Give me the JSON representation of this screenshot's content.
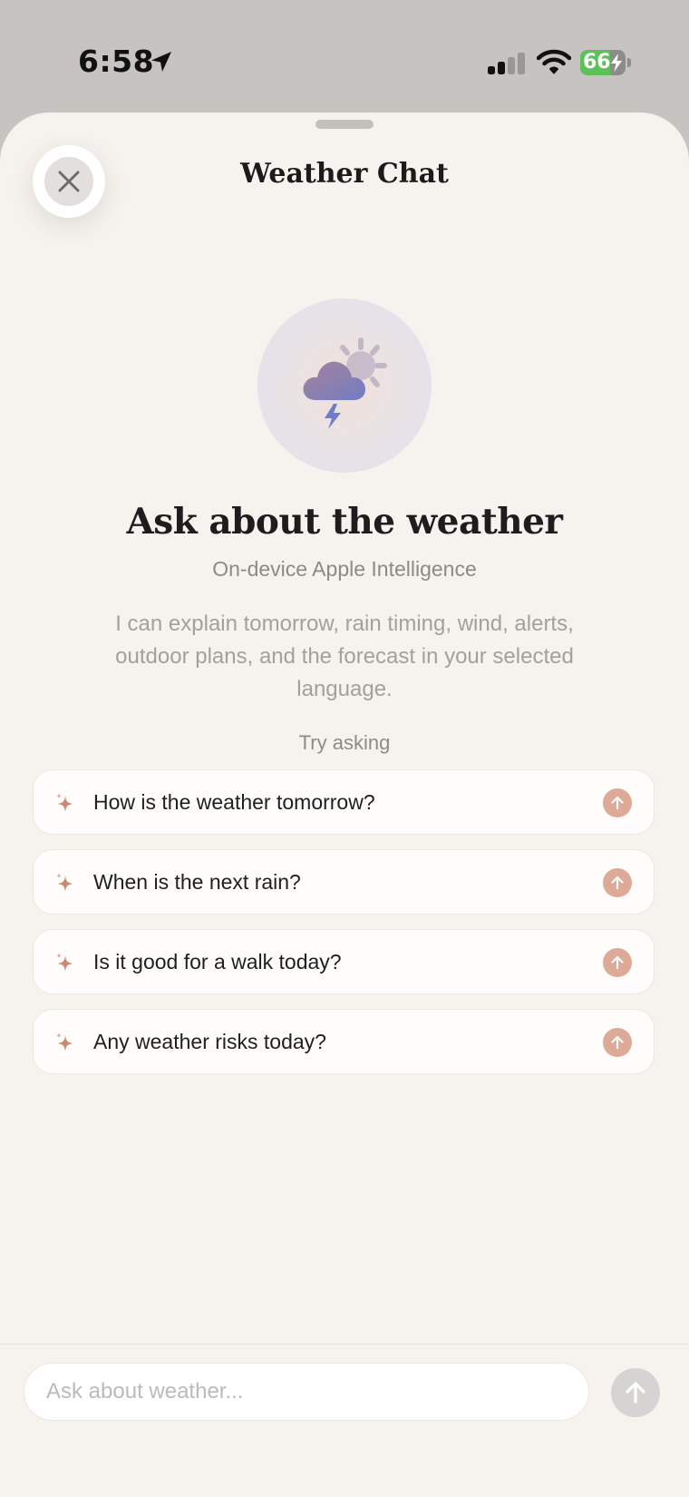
{
  "status_bar": {
    "time": "6:58",
    "battery_level": "66",
    "battery_fraction": 0.66,
    "icons": [
      "location-arrow-icon",
      "cellular-signal-icon",
      "wifi-icon",
      "battery-charging-icon"
    ]
  },
  "sheet": {
    "title": "Weather Chat",
    "close_icon": "close-icon"
  },
  "hero": {
    "icon": "cloud-bolt-sun-icon",
    "heading": "Ask about the weather",
    "subtitle": "On-device Apple Intelligence",
    "description": "I can explain tomorrow, rain timing, wind, alerts, outdoor plans, and the forecast in your selected language."
  },
  "suggestions": {
    "label": "Try asking",
    "items": [
      {
        "text": "How is the weather tomorrow?",
        "icon": "sparkle-icon",
        "action_icon": "arrow-up-icon"
      },
      {
        "text": "When is the next rain?",
        "icon": "sparkle-icon",
        "action_icon": "arrow-up-icon"
      },
      {
        "text": "Is it good for a walk today?",
        "icon": "sparkle-icon",
        "action_icon": "arrow-up-icon"
      },
      {
        "text": "Any weather risks today?",
        "icon": "sparkle-icon",
        "action_icon": "arrow-up-icon"
      }
    ]
  },
  "composer": {
    "placeholder": "Ask about weather...",
    "value": "",
    "send_icon": "arrow-up-icon"
  },
  "colors": {
    "sheet_background": "#f6f2ee",
    "accent": "#dcaa96",
    "sparkle": "#c98a73",
    "card_background": "#fefdfb",
    "battery_green": "#5dc15a"
  }
}
